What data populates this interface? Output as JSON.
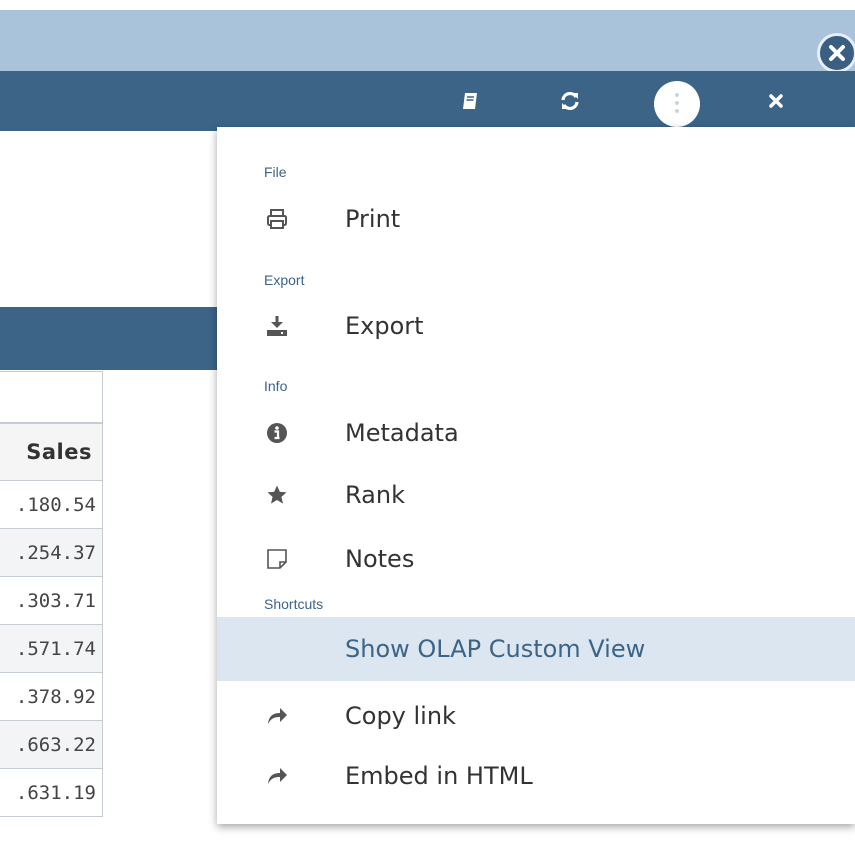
{
  "toolbar": {
    "icons": [
      "book-icon",
      "refresh-icon",
      "more-vertical-icon",
      "close-icon"
    ]
  },
  "titlebar": {
    "close_icon": "close-circle-icon"
  },
  "table": {
    "header": "Sales",
    "cells": [
      ".180.54",
      ".254.37",
      ".303.71",
      ".571.74",
      ".378.92",
      ".663.22",
      ".631.19"
    ]
  },
  "menu": {
    "groups": {
      "file": "File",
      "export": "Export",
      "info": "Info",
      "shortcuts": "Shortcuts"
    },
    "items": {
      "print": {
        "label": "Print",
        "icon": "print-icon"
      },
      "export": {
        "label": "Export",
        "icon": "download-icon"
      },
      "metadata": {
        "label": "Metadata",
        "icon": "info-icon"
      },
      "rank": {
        "label": "Rank",
        "icon": "star-icon"
      },
      "notes": {
        "label": "Notes",
        "icon": "note-icon"
      },
      "olap": {
        "label": "Show OLAP Custom View"
      },
      "copy_link": {
        "label": "Copy link",
        "icon": "share-icon"
      },
      "embed": {
        "label": "Embed in HTML",
        "icon": "share-icon"
      }
    }
  },
  "colors": {
    "titlebar": "#a9c3db",
    "toolbar": "#3b6487",
    "selected": "#dce6f0",
    "accent": "#3b6487"
  }
}
